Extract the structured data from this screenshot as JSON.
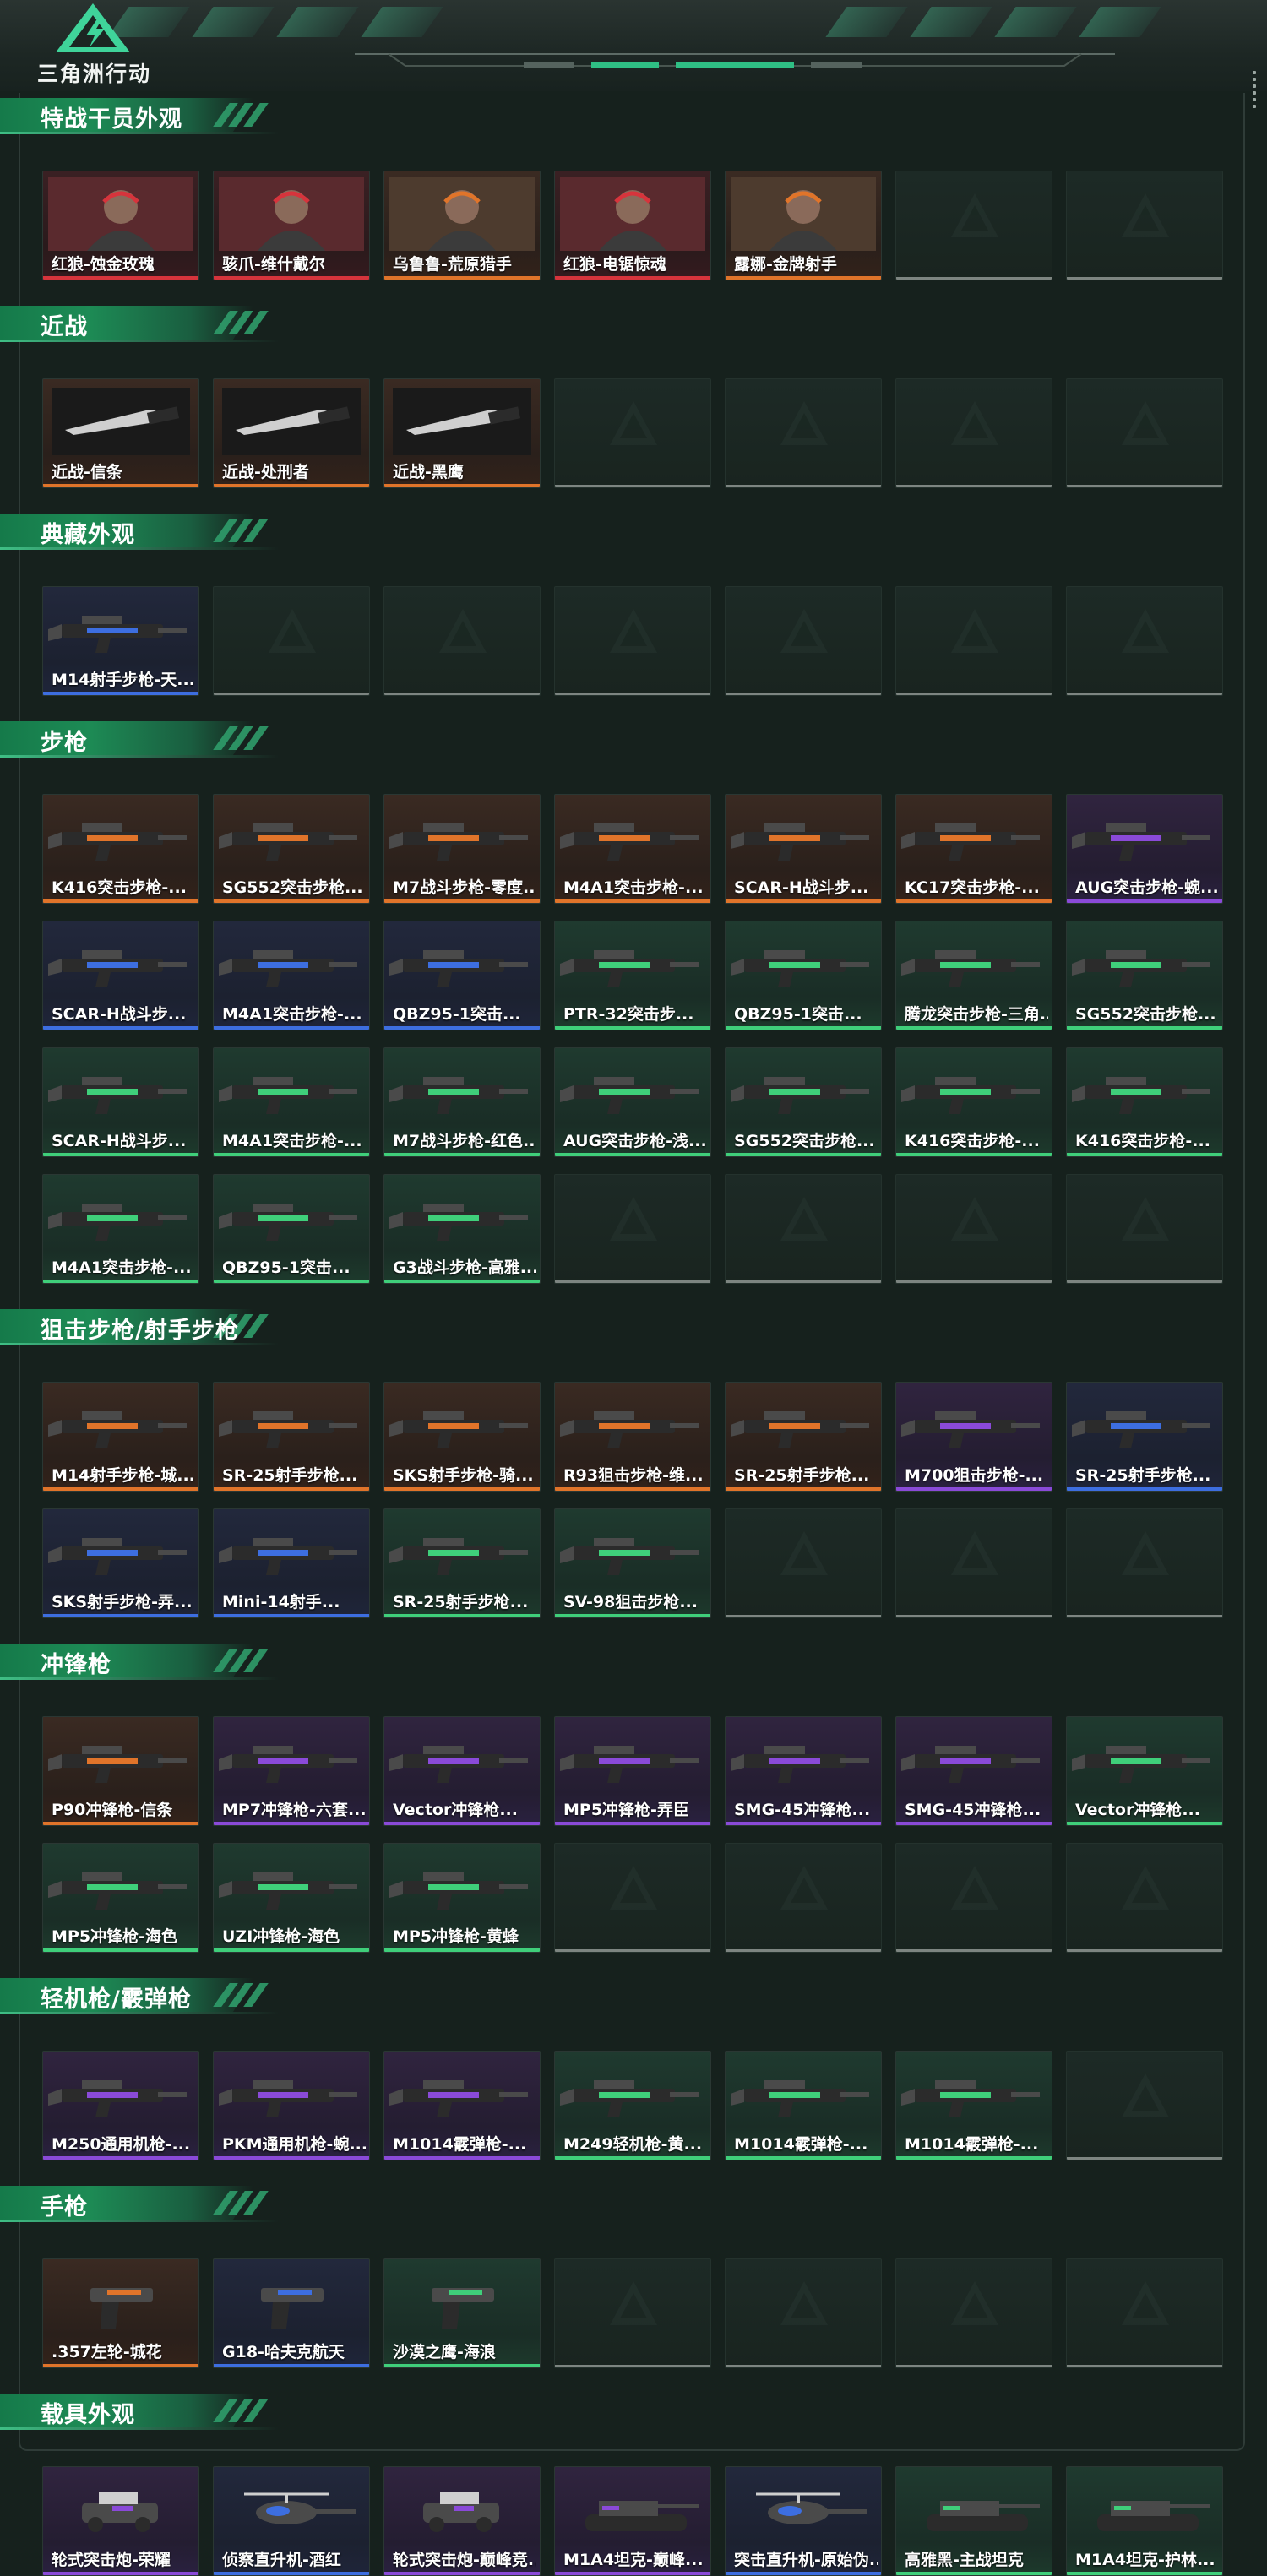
{
  "app": {
    "logo_text": "三角洲行动"
  },
  "colors": {
    "accent": "#1d8b55",
    "rarity": {
      "orange": "#e0742a",
      "red": "#d6343c",
      "blue": "#3d6ee0",
      "purple": "#8a4ad8",
      "green": "#3fcf7a",
      "empty": "#7d8581"
    }
  },
  "sections": [
    {
      "title": "特战干员外观",
      "rows": 1,
      "items": [
        {
          "label": "红狼-蚀金玫瑰",
          "rarity": "red",
          "icon": "operator-portrait-icon"
        },
        {
          "label": "骇爪-维什戴尔",
          "rarity": "red",
          "icon": "operator-portrait-icon"
        },
        {
          "label": "乌鲁鲁-荒原猎手",
          "rarity": "orange",
          "icon": "operator-portrait-icon"
        },
        {
          "label": "红狼-电锯惊魂",
          "rarity": "red",
          "icon": "operator-portrait-icon"
        },
        {
          "label": "露娜-金牌射手",
          "rarity": "orange",
          "icon": "operator-portrait-icon"
        }
      ]
    },
    {
      "title": "近战",
      "rows": 1,
      "items": [
        {
          "label": "近战-信条",
          "rarity": "orange",
          "icon": "knife-icon"
        },
        {
          "label": "近战-处刑者",
          "rarity": "orange",
          "icon": "knife-icon"
        },
        {
          "label": "近战-黑鹰",
          "rarity": "orange",
          "icon": "knife-icon"
        }
      ]
    },
    {
      "title": "典藏外观",
      "rows": 1,
      "items": [
        {
          "label": "M14射手步枪-天...",
          "rarity": "blue",
          "icon": "rifle-icon"
        }
      ]
    },
    {
      "title": "步枪",
      "rows": 4,
      "items": [
        {
          "label": "K416突击步枪-...",
          "rarity": "orange",
          "icon": "rifle-icon"
        },
        {
          "label": "SG552突击步枪...",
          "rarity": "orange",
          "icon": "rifle-icon"
        },
        {
          "label": "M7战斗步枪-零度...",
          "rarity": "orange",
          "icon": "rifle-icon"
        },
        {
          "label": "M4A1突击步枪-...",
          "rarity": "orange",
          "icon": "rifle-icon"
        },
        {
          "label": "SCAR-H战斗步...",
          "rarity": "orange",
          "icon": "rifle-icon"
        },
        {
          "label": "KC17突击步枪-...",
          "rarity": "orange",
          "icon": "rifle-icon"
        },
        {
          "label": "AUG突击步枪-蜿...",
          "rarity": "purple",
          "icon": "rifle-icon"
        },
        {
          "label": "SCAR-H战斗步...",
          "rarity": "blue",
          "icon": "rifle-icon"
        },
        {
          "label": "M4A1突击步枪-...",
          "rarity": "blue",
          "icon": "rifle-icon"
        },
        {
          "label": "QBZ95-1突击...",
          "rarity": "blue",
          "icon": "rifle-icon"
        },
        {
          "label": "PTR-32突击步...",
          "rarity": "green",
          "icon": "rifle-icon"
        },
        {
          "label": "QBZ95-1突击...",
          "rarity": "green",
          "icon": "rifle-icon"
        },
        {
          "label": "腾龙突击步枪-三角...",
          "rarity": "green",
          "icon": "rifle-icon"
        },
        {
          "label": "SG552突击步枪...",
          "rarity": "green",
          "icon": "rifle-icon"
        },
        {
          "label": "SCAR-H战斗步...",
          "rarity": "green",
          "icon": "rifle-icon"
        },
        {
          "label": "M4A1突击步枪-...",
          "rarity": "green",
          "icon": "rifle-icon"
        },
        {
          "label": "M7战斗步枪-红色...",
          "rarity": "green",
          "icon": "rifle-icon"
        },
        {
          "label": "AUG突击步枪-浅...",
          "rarity": "green",
          "icon": "rifle-icon"
        },
        {
          "label": "SG552突击步枪...",
          "rarity": "green",
          "icon": "rifle-icon"
        },
        {
          "label": "K416突击步枪-...",
          "rarity": "green",
          "icon": "rifle-icon"
        },
        {
          "label": "K416突击步枪-...",
          "rarity": "green",
          "icon": "rifle-icon"
        },
        {
          "label": "M4A1突击步枪-...",
          "rarity": "green",
          "icon": "rifle-icon"
        },
        {
          "label": "QBZ95-1突击...",
          "rarity": "green",
          "icon": "rifle-icon"
        },
        {
          "label": "G3战斗步枪-高雅...",
          "rarity": "green",
          "icon": "rifle-icon"
        }
      ]
    },
    {
      "title": "狙击步枪/射手步枪",
      "rows": 2,
      "items": [
        {
          "label": "M14射手步枪-城...",
          "rarity": "orange",
          "icon": "sniper-icon"
        },
        {
          "label": "SR-25射手步枪...",
          "rarity": "orange",
          "icon": "sniper-icon"
        },
        {
          "label": "SKS射手步枪-骑...",
          "rarity": "orange",
          "icon": "sniper-icon"
        },
        {
          "label": "R93狙击步枪-维...",
          "rarity": "orange",
          "icon": "sniper-icon"
        },
        {
          "label": "SR-25射手步枪...",
          "rarity": "orange",
          "icon": "sniper-icon"
        },
        {
          "label": "M700狙击步枪-...",
          "rarity": "purple",
          "icon": "sniper-icon"
        },
        {
          "label": "SR-25射手步枪...",
          "rarity": "blue",
          "icon": "sniper-icon"
        },
        {
          "label": "SKS射手步枪-弄...",
          "rarity": "blue",
          "icon": "sniper-icon"
        },
        {
          "label": "Mini-14射手...",
          "rarity": "blue",
          "icon": "sniper-icon"
        },
        {
          "label": "SR-25射手步枪...",
          "rarity": "green",
          "icon": "sniper-icon"
        },
        {
          "label": "SV-98狙击步枪...",
          "rarity": "green",
          "icon": "sniper-icon"
        }
      ]
    },
    {
      "title": "冲锋枪",
      "rows": 2,
      "items": [
        {
          "label": "P90冲锋枪-信条",
          "rarity": "orange",
          "icon": "smg-icon"
        },
        {
          "label": "MP7冲锋枪-六套...",
          "rarity": "purple",
          "icon": "smg-icon"
        },
        {
          "label": "Vector冲锋枪...",
          "rarity": "purple",
          "icon": "smg-icon"
        },
        {
          "label": "MP5冲锋枪-弄臣",
          "rarity": "purple",
          "icon": "smg-icon"
        },
        {
          "label": "SMG-45冲锋枪...",
          "rarity": "purple",
          "icon": "smg-icon"
        },
        {
          "label": "SMG-45冲锋枪...",
          "rarity": "purple",
          "icon": "smg-icon"
        },
        {
          "label": "Vector冲锋枪...",
          "rarity": "green",
          "icon": "smg-icon"
        },
        {
          "label": "MP5冲锋枪-海色",
          "rarity": "green",
          "icon": "smg-icon"
        },
        {
          "label": "UZI冲锋枪-海色",
          "rarity": "green",
          "icon": "smg-icon"
        },
        {
          "label": "MP5冲锋枪-黄蜂",
          "rarity": "green",
          "icon": "smg-icon"
        }
      ]
    },
    {
      "title": "轻机枪/霰弹枪",
      "rows": 1,
      "items": [
        {
          "label": "M250通用机枪-...",
          "rarity": "purple",
          "icon": "machinegun-icon"
        },
        {
          "label": "PKM通用机枪-蜿...",
          "rarity": "purple",
          "icon": "machinegun-icon"
        },
        {
          "label": "M1014霰弹枪-...",
          "rarity": "purple",
          "icon": "shotgun-icon"
        },
        {
          "label": "M249轻机枪-黄...",
          "rarity": "green",
          "icon": "machinegun-icon"
        },
        {
          "label": "M1014霰弹枪-...",
          "rarity": "green",
          "icon": "shotgun-icon"
        },
        {
          "label": "M1014霰弹枪-...",
          "rarity": "green",
          "icon": "shotgun-icon"
        }
      ]
    },
    {
      "title": "手枪",
      "rows": 1,
      "items": [
        {
          "label": ".357左轮-城花",
          "rarity": "orange",
          "icon": "pistol-icon"
        },
        {
          "label": "G18-哈夫克航天",
          "rarity": "blue",
          "icon": "pistol-icon"
        },
        {
          "label": "沙漠之鹰-海浪",
          "rarity": "green",
          "icon": "pistol-icon"
        }
      ]
    },
    {
      "title": "载具外观",
      "rows": 1,
      "items": [
        {
          "label": "轮式突击炮-荣耀",
          "rarity": "purple",
          "icon": "vehicle-icon"
        },
        {
          "label": "侦察直升机-酒红",
          "rarity": "blue",
          "icon": "helicopter-icon"
        },
        {
          "label": "轮式突击炮-巅峰竞...",
          "rarity": "purple",
          "icon": "vehicle-icon"
        },
        {
          "label": "M1A4坦克-巅峰...",
          "rarity": "purple",
          "icon": "tank-icon"
        },
        {
          "label": "突击直升机-原始伪...",
          "rarity": "blue",
          "icon": "helicopter-icon"
        },
        {
          "label": "高雅黑-主战坦克",
          "rarity": "green",
          "icon": "tank-icon"
        },
        {
          "label": "M1A4坦克-护林...",
          "rarity": "green",
          "icon": "tank-icon"
        }
      ]
    }
  ]
}
